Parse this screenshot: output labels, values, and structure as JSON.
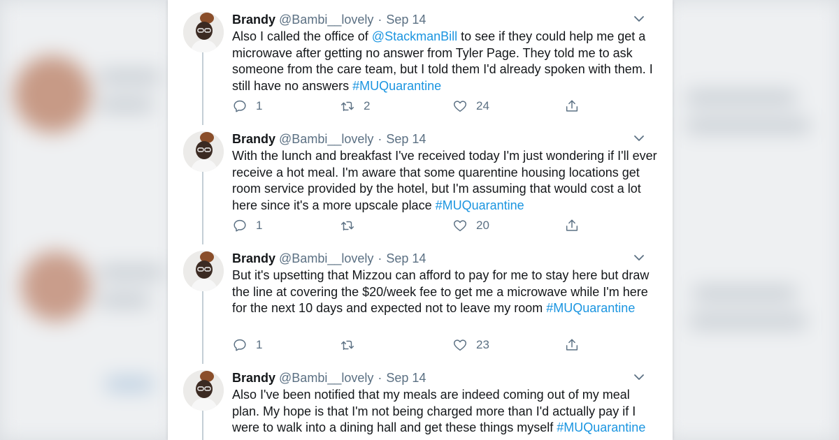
{
  "colors": {
    "text": "#14171a",
    "secondary": "#5b7083",
    "link": "#1b95e0",
    "thread_line": "#c4cfd6"
  },
  "tweets": [
    {
      "name": "Brandy",
      "handle": "@Bambi__lovely",
      "separator": "·",
      "date": "Sep 14",
      "text_segments": [
        {
          "type": "text",
          "value": "Also I called the office of "
        },
        {
          "type": "link",
          "value": "@StackmanBill"
        },
        {
          "type": "text",
          "value": " to see if they could help me get a microwave after getting no answer from Tyler Page. They told me to ask someone from the care team, but I told them I'd already spoken with them. I still have no answers "
        },
        {
          "type": "link",
          "value": "#MUQuarantine"
        }
      ],
      "replies": "1",
      "retweets": "2",
      "likes": "24"
    },
    {
      "name": "Brandy",
      "handle": "@Bambi__lovely",
      "separator": "·",
      "date": "Sep 14",
      "text_segments": [
        {
          "type": "text",
          "value": "With the lunch and breakfast I've received today I'm just wondering if I'll ever receive a hot meal. I'm aware that some quarentine housing locations get room service provided by the hotel, but I'm assuming that would cost a lot here since it's a more upscale place "
        },
        {
          "type": "link",
          "value": "#MUQuarantine"
        }
      ],
      "replies": "1",
      "retweets": "",
      "likes": "20"
    },
    {
      "name": "Brandy",
      "handle": "@Bambi__lovely",
      "separator": "·",
      "date": "Sep 14",
      "text_segments": [
        {
          "type": "text",
          "value": "But it's upsetting that Mizzou can afford to pay for me to stay here but draw the line at covering the $20/week fee to get me a microwave while I'm here for the next 10 days and expected not to leave my room "
        },
        {
          "type": "link",
          "value": "#MUQuarantine"
        }
      ],
      "replies": "1",
      "retweets": "",
      "likes": "23"
    },
    {
      "name": "Brandy",
      "handle": "@Bambi__lovely",
      "separator": "·",
      "date": "Sep 14",
      "text_segments": [
        {
          "type": "text",
          "value": "Also I've been notified that my meals are indeed coming out of my meal plan. My hope is that I'm not being charged more than I'd actually pay if I were to walk into a dining hall and get these things myself "
        },
        {
          "type": "link",
          "value": "#MUQuarantine"
        }
      ]
    }
  ]
}
